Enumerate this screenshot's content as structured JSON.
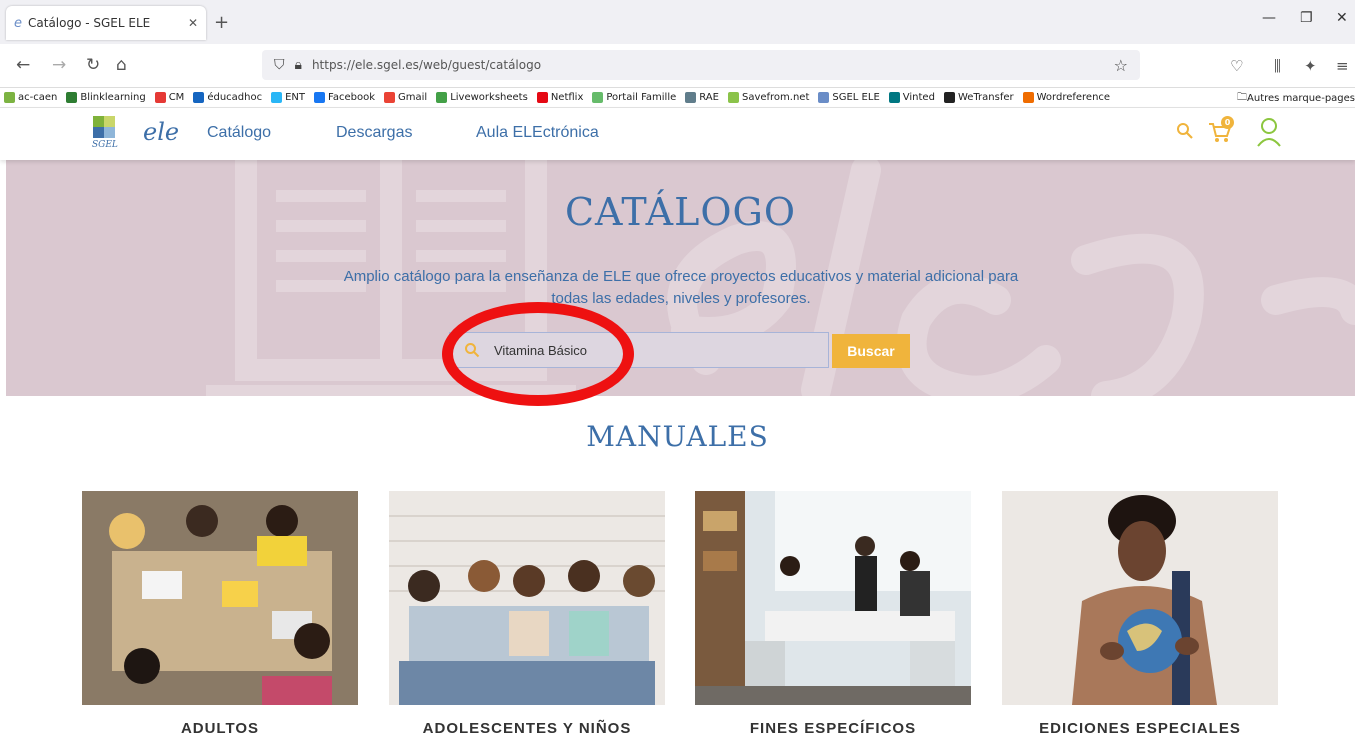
{
  "browser": {
    "tab_title": "Catálogo - SGEL ELE",
    "url": "https://ele.sgel.es/web/guest/catálogo",
    "bookmarks": [
      {
        "label": "ac-caen",
        "color": "#7cb342"
      },
      {
        "label": "Blinklearning",
        "color": "#2e7d32"
      },
      {
        "label": "CM",
        "color": "#e53935"
      },
      {
        "label": "éducadhoc",
        "color": "#1565c0"
      },
      {
        "label": "ENT",
        "color": "#29b6f6"
      },
      {
        "label": "Facebook",
        "color": "#1877f2"
      },
      {
        "label": "Gmail",
        "color": "#ea4335"
      },
      {
        "label": "Liveworksheets",
        "color": "#43a047"
      },
      {
        "label": "Netflix",
        "color": "#e50914"
      },
      {
        "label": "Portail Famille",
        "color": "#66bb6a"
      },
      {
        "label": "RAE",
        "color": "#607d8b"
      },
      {
        "label": "Savefrom.net",
        "color": "#8bc34a"
      },
      {
        "label": "SGEL ELE",
        "color": "#6a8dc7"
      },
      {
        "label": "Vinted",
        "color": "#007782"
      },
      {
        "label": "WeTransfer",
        "color": "#222222"
      },
      {
        "label": "Wordreference",
        "color": "#ef6c00"
      }
    ],
    "other_bookmarks": "Autres marque-pages"
  },
  "header": {
    "logo_sgel": "SGEL",
    "logo_ele": "ele",
    "menu": [
      "Catálogo",
      "Descargas",
      "Aula ELEctrónica"
    ],
    "cart_count": "0"
  },
  "hero": {
    "title": "CATÁLOGO",
    "description": "Amplio catálogo para la enseñanza de ELE que ofrece proyectos educativos y material adicional para todas las edades, niveles y profesores.",
    "search_value": "Vitamina Básico",
    "search_button": "Buscar"
  },
  "manuales": {
    "title": "MANUALES",
    "categories": [
      "ADULTOS",
      "ADOLESCENTES Y NIÑOS",
      "FINES ESPECÍFICOS",
      "EDICIONES ESPECIALES"
    ]
  },
  "colors": {
    "brand": "#3d6fa8",
    "accent": "#f0b43c",
    "hero_bg": "#dac8d0"
  }
}
